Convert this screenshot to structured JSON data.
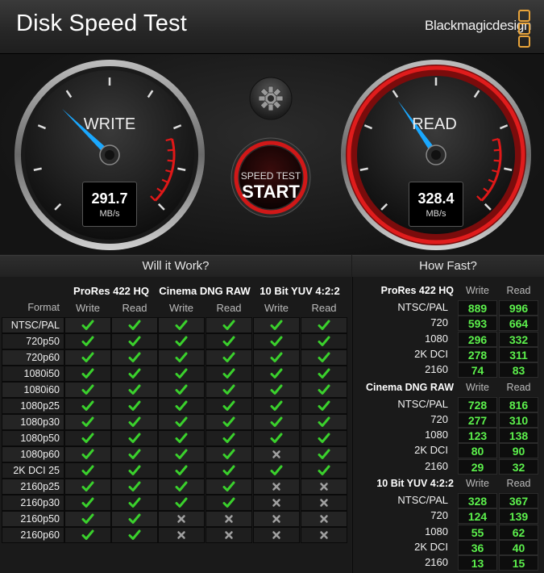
{
  "title": "Disk Speed Test",
  "brand": "Blackmagicdesign",
  "gauges": {
    "write": {
      "label": "WRITE",
      "value": "291.7",
      "unit": "MB/s",
      "fraction": 0.33
    },
    "read": {
      "label": "READ",
      "value": "328.4",
      "unit": "MB/s",
      "fraction": 0.37
    }
  },
  "start_button": {
    "small_label": "SPEED TEST",
    "big_label": "START"
  },
  "will_it_work": {
    "title": "Will it Work?",
    "format_label": "Format",
    "groups": [
      "ProRes 422 HQ",
      "Cinema DNG RAW",
      "10 Bit YUV 4:2:2"
    ],
    "col_heads": [
      "Write",
      "Read",
      "Write",
      "Read",
      "Write",
      "Read"
    ],
    "rows": [
      {
        "label": "NTSC/PAL",
        "cells": [
          1,
          1,
          1,
          1,
          1,
          1
        ]
      },
      {
        "label": "720p50",
        "cells": [
          1,
          1,
          1,
          1,
          1,
          1
        ]
      },
      {
        "label": "720p60",
        "cells": [
          1,
          1,
          1,
          1,
          1,
          1
        ]
      },
      {
        "label": "1080i50",
        "cells": [
          1,
          1,
          1,
          1,
          1,
          1
        ]
      },
      {
        "label": "1080i60",
        "cells": [
          1,
          1,
          1,
          1,
          1,
          1
        ]
      },
      {
        "label": "1080p25",
        "cells": [
          1,
          1,
          1,
          1,
          1,
          1
        ]
      },
      {
        "label": "1080p30",
        "cells": [
          1,
          1,
          1,
          1,
          1,
          1
        ]
      },
      {
        "label": "1080p50",
        "cells": [
          1,
          1,
          1,
          1,
          1,
          1
        ]
      },
      {
        "label": "1080p60",
        "cells": [
          1,
          1,
          1,
          1,
          0,
          1
        ]
      },
      {
        "label": "2K DCI 25",
        "cells": [
          1,
          1,
          1,
          1,
          1,
          1
        ]
      },
      {
        "label": "2160p25",
        "cells": [
          1,
          1,
          1,
          1,
          0,
          0
        ]
      },
      {
        "label": "2160p30",
        "cells": [
          1,
          1,
          1,
          1,
          0,
          0
        ]
      },
      {
        "label": "2160p50",
        "cells": [
          1,
          1,
          0,
          0,
          0,
          0
        ]
      },
      {
        "label": "2160p60",
        "cells": [
          1,
          1,
          0,
          0,
          0,
          0
        ]
      }
    ]
  },
  "how_fast": {
    "title": "How Fast?",
    "write_head": "Write",
    "read_head": "Read",
    "groups": [
      {
        "name": "ProRes 422 HQ",
        "rows": [
          {
            "label": "NTSC/PAL",
            "write": "889",
            "read": "996"
          },
          {
            "label": "720",
            "write": "593",
            "read": "664"
          },
          {
            "label": "1080",
            "write": "296",
            "read": "332"
          },
          {
            "label": "2K DCI",
            "write": "278",
            "read": "311"
          },
          {
            "label": "2160",
            "write": "74",
            "read": "83"
          }
        ]
      },
      {
        "name": "Cinema DNG RAW",
        "rows": [
          {
            "label": "NTSC/PAL",
            "write": "728",
            "read": "816"
          },
          {
            "label": "720",
            "write": "277",
            "read": "310"
          },
          {
            "label": "1080",
            "write": "123",
            "read": "138"
          },
          {
            "label": "2K DCI",
            "write": "80",
            "read": "90"
          },
          {
            "label": "2160",
            "write": "29",
            "read": "32"
          }
        ]
      },
      {
        "name": "10 Bit YUV 4:2:2",
        "rows": [
          {
            "label": "NTSC/PAL",
            "write": "328",
            "read": "367"
          },
          {
            "label": "720",
            "write": "124",
            "read": "139"
          },
          {
            "label": "1080",
            "write": "55",
            "read": "62"
          },
          {
            "label": "2K DCI",
            "write": "36",
            "read": "40"
          },
          {
            "label": "2160",
            "write": "13",
            "read": "15"
          }
        ]
      }
    ]
  },
  "colors": {
    "accent": "#1aa8ff",
    "ok": "#3ad12c",
    "fail": "#a0a0a0",
    "red": "#d01818",
    "number": "#5cf04c"
  }
}
